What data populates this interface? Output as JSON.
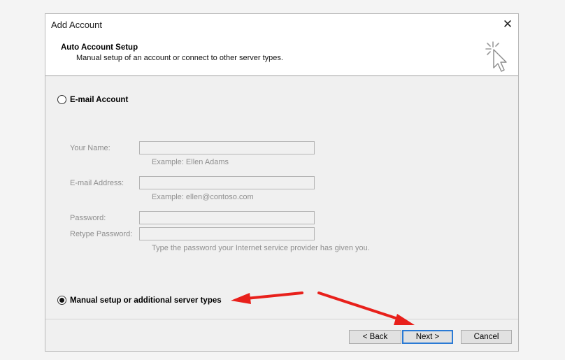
{
  "window": {
    "title": "Add Account",
    "close_glyph": "✕"
  },
  "header": {
    "title": "Auto Account Setup",
    "subtitle": "Manual setup of an account or connect to other server types.",
    "icon": "cursor-click-icon"
  },
  "email_account": {
    "label": "E-mail Account",
    "selected": false,
    "fields": [
      {
        "label": "Your Name:",
        "value": "",
        "hint": "Example: Ellen Adams"
      },
      {
        "label": "E-mail Address:",
        "value": "",
        "hint": "Example: ellen@contoso.com"
      },
      {
        "label": "Password:",
        "value": ""
      },
      {
        "label": "Retype Password:",
        "value": "",
        "hint": "Type the password your Internet service provider has given you."
      }
    ]
  },
  "manual_setup": {
    "label": "Manual setup or additional server types",
    "selected": true
  },
  "buttons": {
    "back": "< Back",
    "next": "Next >",
    "cancel": "Cancel"
  },
  "colors": {
    "annotation_arrow": "#e8201b",
    "default_button_border": "#2a7ad5"
  }
}
